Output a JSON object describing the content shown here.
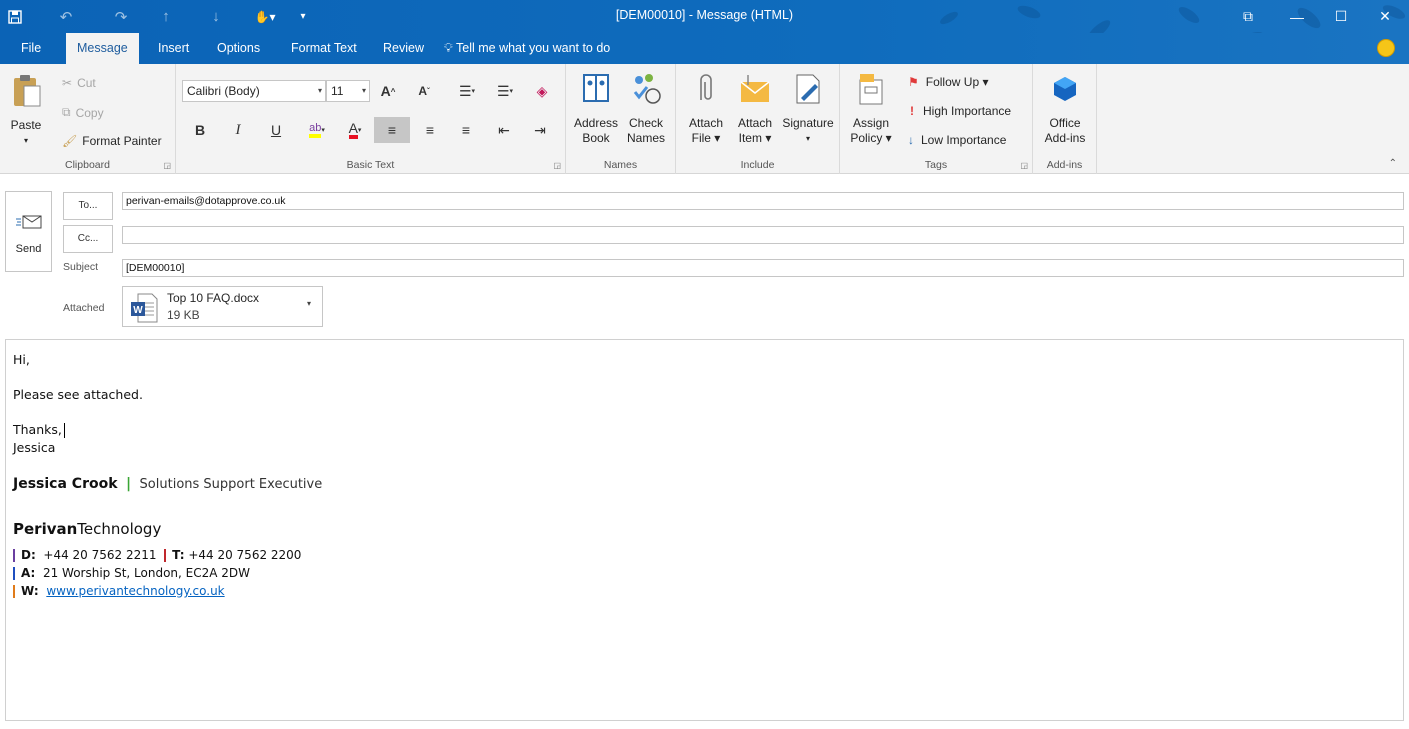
{
  "window": {
    "title": "[DEM00010]  -  Message (HTML)",
    "controls": {
      "restore": "⧉",
      "minimize": "—",
      "maximize": "☐",
      "close": "✕"
    }
  },
  "quick_access": {
    "save": "save-icon",
    "undo": "undo-icon",
    "redo": "redo-icon",
    "up": "up-arrow-icon",
    "down": "down-arrow-icon",
    "touch": "touch-mode-icon",
    "customize": "customize-icon"
  },
  "tabs": [
    {
      "label": "File"
    },
    {
      "label": "Message",
      "active": true
    },
    {
      "label": "Insert"
    },
    {
      "label": "Options"
    },
    {
      "label": "Format Text"
    },
    {
      "label": "Review"
    }
  ],
  "tell_me": "Tell me what you want to do",
  "ribbon": {
    "clipboard": {
      "paste": "Paste",
      "cut": "Cut",
      "copy": "Copy",
      "format_painter": "Format Painter",
      "label": "Clipboard"
    },
    "basic_text": {
      "font": "Calibri (Body)",
      "size": "11",
      "label": "Basic Text",
      "bold": "B",
      "italic": "I",
      "underline": "U",
      "font_color": "A",
      "grow": "A",
      "shrink": "A"
    },
    "names": {
      "address_book_1": "Address",
      "address_book_2": "Book",
      "check_names_1": "Check",
      "check_names_2": "Names",
      "label": "Names"
    },
    "include": {
      "attach_file_1": "Attach",
      "attach_file_2": "File ▾",
      "attach_item_1": "Attach",
      "attach_item_2": "Item ▾",
      "signature_1": "Signature",
      "signature_2": "▾",
      "label": "Include"
    },
    "tags": {
      "assign_policy_1": "Assign",
      "assign_policy_2": "Policy ▾",
      "follow_up": "Follow Up ▾",
      "high_importance": "High Importance",
      "low_importance": "Low Importance",
      "label": "Tags"
    },
    "addins": {
      "office_addins_1": "Office",
      "office_addins_2": "Add-ins",
      "label": "Add-ins"
    }
  },
  "compose": {
    "send": "Send",
    "to_button": "To...",
    "cc_button": "Cc...",
    "to_value": "perivan-emails@dotapprove.co.uk",
    "cc_value": "",
    "subject_label": "Subject",
    "subject_value": "[DEM00010]",
    "attached_label": "Attached",
    "attachment": {
      "name": "Top 10 FAQ.docx",
      "size": "19 KB"
    }
  },
  "body": {
    "greeting": "Hi,",
    "line1": "Please see attached.",
    "thanks": "Thanks,",
    "name": "Jessica",
    "sig_name": "Jessica Crook",
    "sig_sep": "|",
    "sig_title": "Solutions Support Executive",
    "company_bold": "Perivan",
    "company_rest": "Technology",
    "d_label": "D:",
    "d_value": "+44 20 7562 2211",
    "t_label": "T:",
    "t_value": "+44 20 7562 2200",
    "a_label": "A:",
    "a_value": "21 Worship St, London, EC2A 2DW",
    "w_label": "W:",
    "w_value": "www.perivantechnology.co.uk"
  },
  "colors": {
    "accent": "#0f6cbd",
    "sig_green": "#3aa635",
    "bar_purple": "#6a3fa0",
    "bar_red": "#c0282d",
    "bar_blue": "#1f4fbf",
    "bar_orange": "#e07b1a"
  }
}
